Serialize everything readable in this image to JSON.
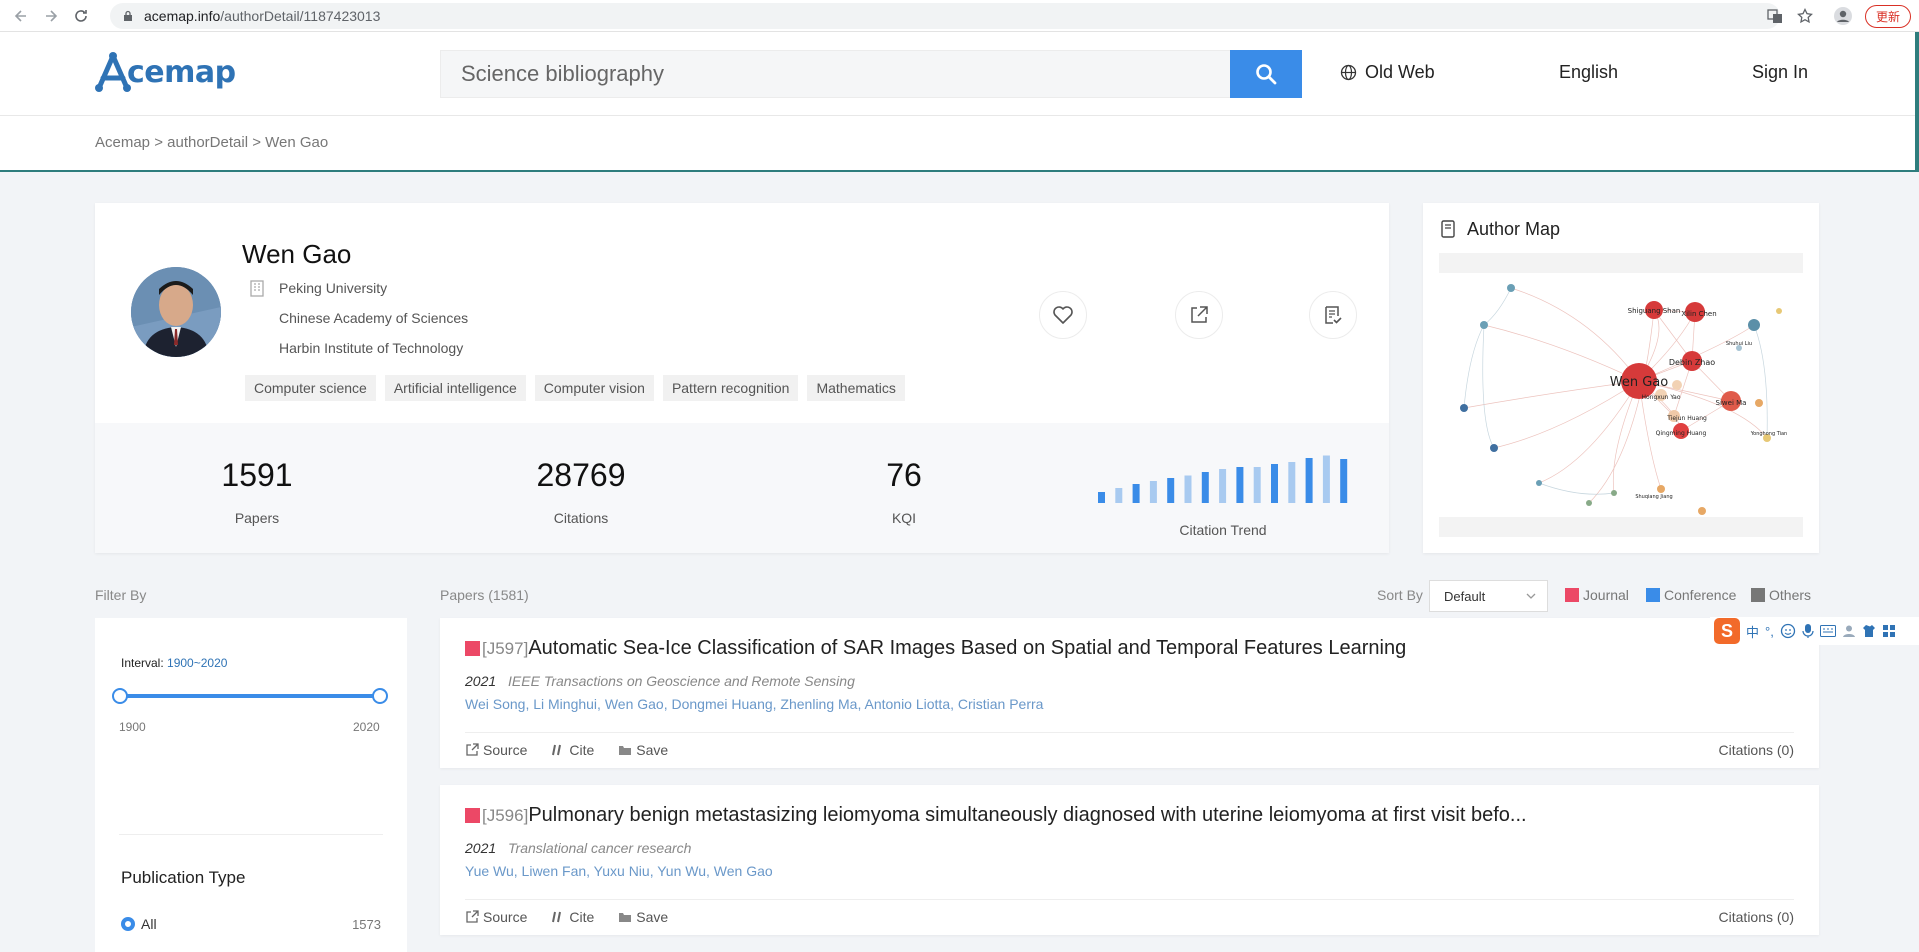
{
  "browser": {
    "url_host": "acemap.info",
    "url_path": "/authorDetail/1187423013",
    "update_label": "更新"
  },
  "header": {
    "logo_text": "cemap",
    "search_placeholder": "Science bibliography",
    "old_web": "Old Web",
    "language": "English",
    "sign_in": "Sign In"
  },
  "breadcrumb": {
    "root": "Acemap",
    "sep1": " > ",
    "section": "authorDetail",
    "sep2": " > ",
    "current": "Wen Gao"
  },
  "author": {
    "name": "Wen Gao",
    "affiliations": [
      "Peking University",
      "Chinese Academy of Sciences",
      "Harbin Institute of Technology"
    ],
    "tags": [
      "Computer science",
      "Artificial intelligence",
      "Computer vision",
      "Pattern recognition",
      "Mathematics"
    ]
  },
  "stats": {
    "papers": {
      "value": "1591",
      "label": "Papers"
    },
    "citations": {
      "value": "28769",
      "label": "Citations"
    },
    "kqi": {
      "value": "76",
      "label": "KQI"
    },
    "trend_label": "Citation Trend"
  },
  "citation_trend_relative": [
    0.22,
    0.3,
    0.38,
    0.44,
    0.5,
    0.55,
    0.62,
    0.68,
    0.72,
    0.72,
    0.78,
    0.82,
    0.9,
    0.95,
    0.88,
    0.02
  ],
  "author_map": {
    "title": "Author Map",
    "center": "Wen Gao",
    "nodes": [
      "Shiguang Shan",
      "Xilin Chen",
      "Debin Zhao",
      "Hongxun Yao",
      "Siwei Ma",
      "Tiejun Huang",
      "Qingming Huang",
      "Shuhui Liu",
      "Yonghong Tian",
      "Shuqiang Jiang"
    ]
  },
  "filter": {
    "label": "Filter By",
    "interval_label": "Interval:",
    "interval_value": "1900~2020",
    "min": "1900",
    "max": "2020",
    "pub_type_title": "Publication Type",
    "options": [
      {
        "label": "All",
        "count": "1573"
      }
    ]
  },
  "papers_header": {
    "count_label": "Papers (1581)",
    "sort_label": "Sort By",
    "sort_value": "Default",
    "legend": [
      {
        "label": "Journal",
        "color": "#ec4866"
      },
      {
        "label": "Conference",
        "color": "#3a8ce8"
      },
      {
        "label": "Others",
        "color": "#777777"
      }
    ]
  },
  "papers": [
    {
      "code": "[J597]",
      "title": "Automatic Sea-Ice Classification of SAR Images Based on Spatial and Temporal Features Learning",
      "year": "2021",
      "venue": "IEEE Transactions on Geoscience and Remote Sensing",
      "authors": "Wei Song, Li Minghui, Wen Gao, Dongmei Huang, Zhenling Ma, Antonio Liotta, Cristian Perra",
      "source": "Source",
      "cite": "Cite",
      "save": "Save",
      "citations": "Citations (0)"
    },
    {
      "code": "[J596]",
      "title": "Pulmonary benign metastasizing leiomyoma simultaneously diagnosed with uterine leiomyoma at first visit befo...",
      "year": "2021",
      "venue": "Translational cancer research",
      "authors": "Yue Wu, Liwen Fan, Yuxu Niu, Yun Wu, Wen Gao",
      "source": "Source",
      "cite": "Cite",
      "save": "Save",
      "citations": "Citations (0)"
    }
  ],
  "ime": {
    "label": "中"
  }
}
